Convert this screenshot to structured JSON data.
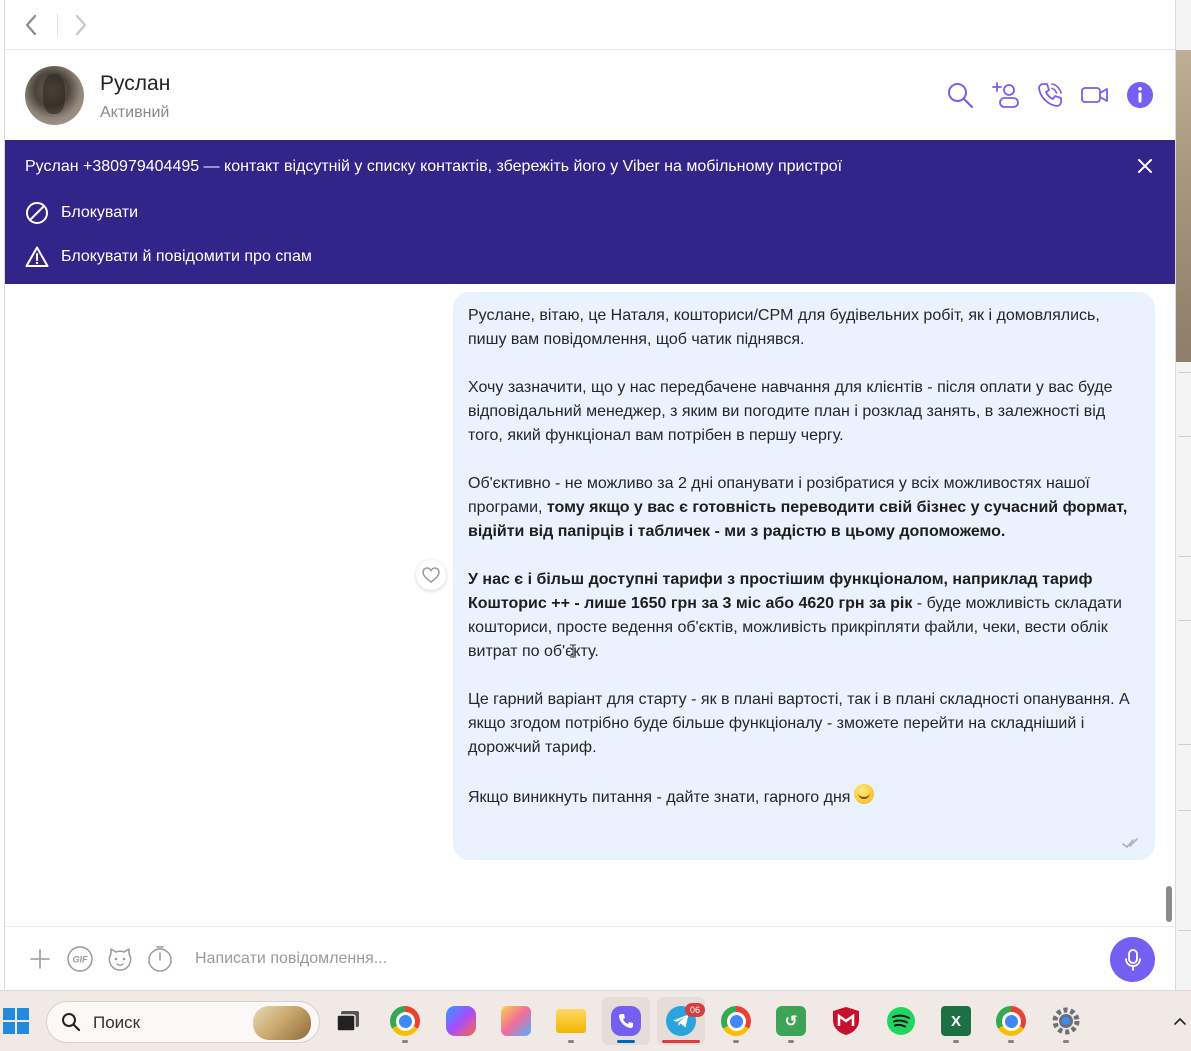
{
  "window": {
    "nav": {
      "back_icon": "chevron-left-icon",
      "forward_icon": "chevron-right-icon"
    }
  },
  "header": {
    "name": "Руслан",
    "status": "Активний",
    "icons": [
      "search-icon",
      "add-participant-icon",
      "phone-icon",
      "video-icon",
      "info-icon"
    ]
  },
  "banner": {
    "text": "Руслан +380979404495 — контакт відсутній у списку контактів, збережіть його у Viber на мобільному пристрої",
    "block_label": "Блокувати",
    "block_report_label": "Блокувати й повідомити про спам",
    "bg_color": "#33248a"
  },
  "message": {
    "p1": "Руслане, вітаю, це Наталя, кошториси/CPM для будівельних робіт, як і домовлялись, пишу вам повідомлення, щоб чатик піднявся.",
    "p2": "Хочу зазначити, що у нас передбачене навчання для клієнтів - після оплати у вас буде відповідальний менеджер, з яким ви погодите план і розклад занять, в залежності від того, який функціонал вам потрібен в першу чергу.",
    "p3_normal": "Об'єктивно - не можливо за 2 дні опанувати і розібратися у всіх можливостях нашої програми, ",
    "p3_bold": "тому якщо у вас є готовність переводити свій бізнес у сучасний формат, відійти від папірців і табличек - ми з радістю в цьому допоможемо.",
    "p4_bold": "У нас є і більш доступні тарифи з простішим функціоналом, наприклад тариф Кошторис ++ - лише 1650 грн за 3 міс або 4620 грн за рік",
    "p4_normal": " - буде можливість складати кошториси, просте ведення об'єктів, можливість прикріпляти файли, чеки, вести облік витрат по об'єкту.",
    "p5": "Це гарний варіант для старту - як в плані вартості, так і в плані складності опанування. А якщо згодом потрібно буде більше функціоналу - зможете перейти на складніший і дорожчий тариф.",
    "p6": "Якщо виникнуть питання - дайте знати, гарного дня",
    "emoji": "smiling-face-emoji",
    "bubble_color": "#e9f2fd"
  },
  "composer": {
    "placeholder": "Написати повідомлення...",
    "icons": [
      "plus-icon",
      "gif-icon",
      "sticker-icon",
      "timer-icon",
      "microphone-icon"
    ],
    "accent": "#7360f2"
  },
  "taskbar": {
    "search_label": "Поиск",
    "telegram_badge": "06",
    "apps": [
      "windows-start-icon",
      "task-view-icon",
      "chrome-icon",
      "copilot-icon",
      "paint-icon",
      "file-explorer-icon",
      "viber-icon",
      "telegram-icon",
      "chrome-profile-icon",
      "green-app-icon",
      "mcafee-icon",
      "spotify-icon",
      "excel-icon",
      "chrome-profile-2-icon",
      "settings-icon"
    ]
  }
}
